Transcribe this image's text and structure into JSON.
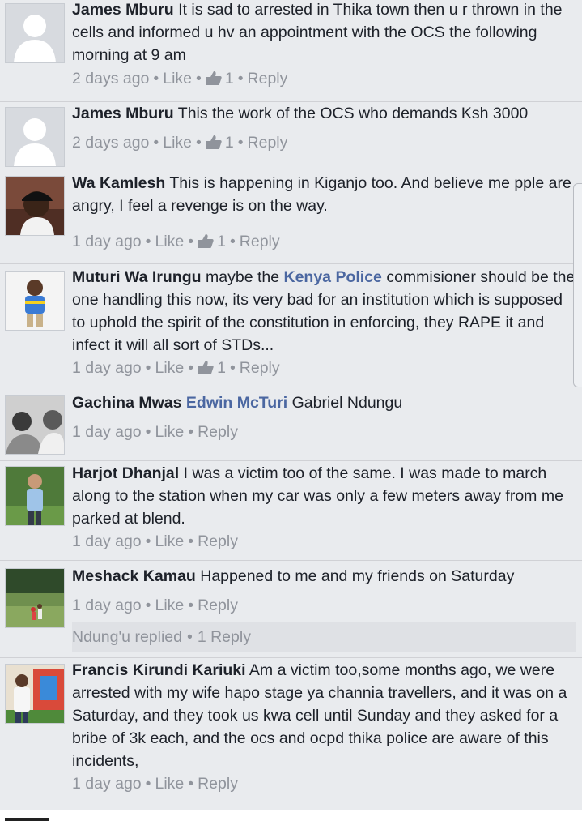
{
  "comments": [
    {
      "author": "James Mburu",
      "text": "It is sad to arrested in Thika town then u r thrown in the cells and informed u hv an appointment with the OCS the following morning at 9 am",
      "time": "2 days ago",
      "like": "Like",
      "likes": "1",
      "reply": "Reply",
      "avatar": "default-profile"
    },
    {
      "author": "James Mburu",
      "text": "This the work of the OCS who demands Ksh 3000",
      "time": "2 days ago",
      "like": "Like",
      "likes": "1",
      "reply": "Reply",
      "avatar": "default-profile"
    },
    {
      "author": "Wa Kamlesh",
      "text": "This is happening in Kiganjo too. And believe me pple are angry, I feel a revenge is on the way.",
      "time": "1 day ago",
      "like": "Like",
      "likes": "1",
      "reply": "Reply",
      "avatar": "photo-man-cap"
    },
    {
      "author": "Muturi Wa Irungu",
      "text_before": "maybe the",
      "mention": "Kenya Police",
      "text_after": "commisioner should be the one handling this now, its very bad for an institution which is supposed to uphold the spirit of the constitution in enforcing, they RAPE it and infect it will all sort of STDs...",
      "time": "1 day ago",
      "like": "Like",
      "likes": "1",
      "reply": "Reply",
      "avatar": "photo-child"
    },
    {
      "author": "Gachina Mwas",
      "mention": "Edwin McTuri",
      "text_after": "Gabriel Ndungu",
      "time": "1 day ago",
      "like": "Like",
      "reply": "Reply",
      "avatar": "photo-bw-group"
    },
    {
      "author": "Harjot Dhanjal",
      "text": "I was a victim too of the same. I was made to march along to the station when my car was only a few meters away from me parked at blend.",
      "time": "1 day ago",
      "like": "Like",
      "reply": "Reply",
      "avatar": "photo-man-outdoors"
    },
    {
      "author": "Meshack Kamau",
      "text": "Happened to me and my friends on Saturday",
      "time": "1 day ago",
      "like": "Like",
      "reply": "Reply",
      "replies_summary": "Ndung'u replied",
      "replies_count": "1 Reply",
      "avatar": "photo-field"
    },
    {
      "author": "Francis Kirundi Kariuki",
      "text": "Am a victim too,some months ago, we were arrested with my wife hapo stage ya channia travellers, and it was on a Saturday, and they took us kwa cell until Sunday and they asked for a bribe of 3k each, and the ocs and ocpd thika police are aware of this incidents,",
      "time": "1 day ago",
      "like": "Like",
      "reply": "Reply",
      "avatar": "photo-man-mural"
    }
  ],
  "colors": {
    "background": "#e9ebee",
    "link": "#4b67a1",
    "meta": "#90949c",
    "text": "#1d2129"
  },
  "icons": {
    "like": "thumbs-up-icon",
    "separator": "bullet-dot"
  }
}
